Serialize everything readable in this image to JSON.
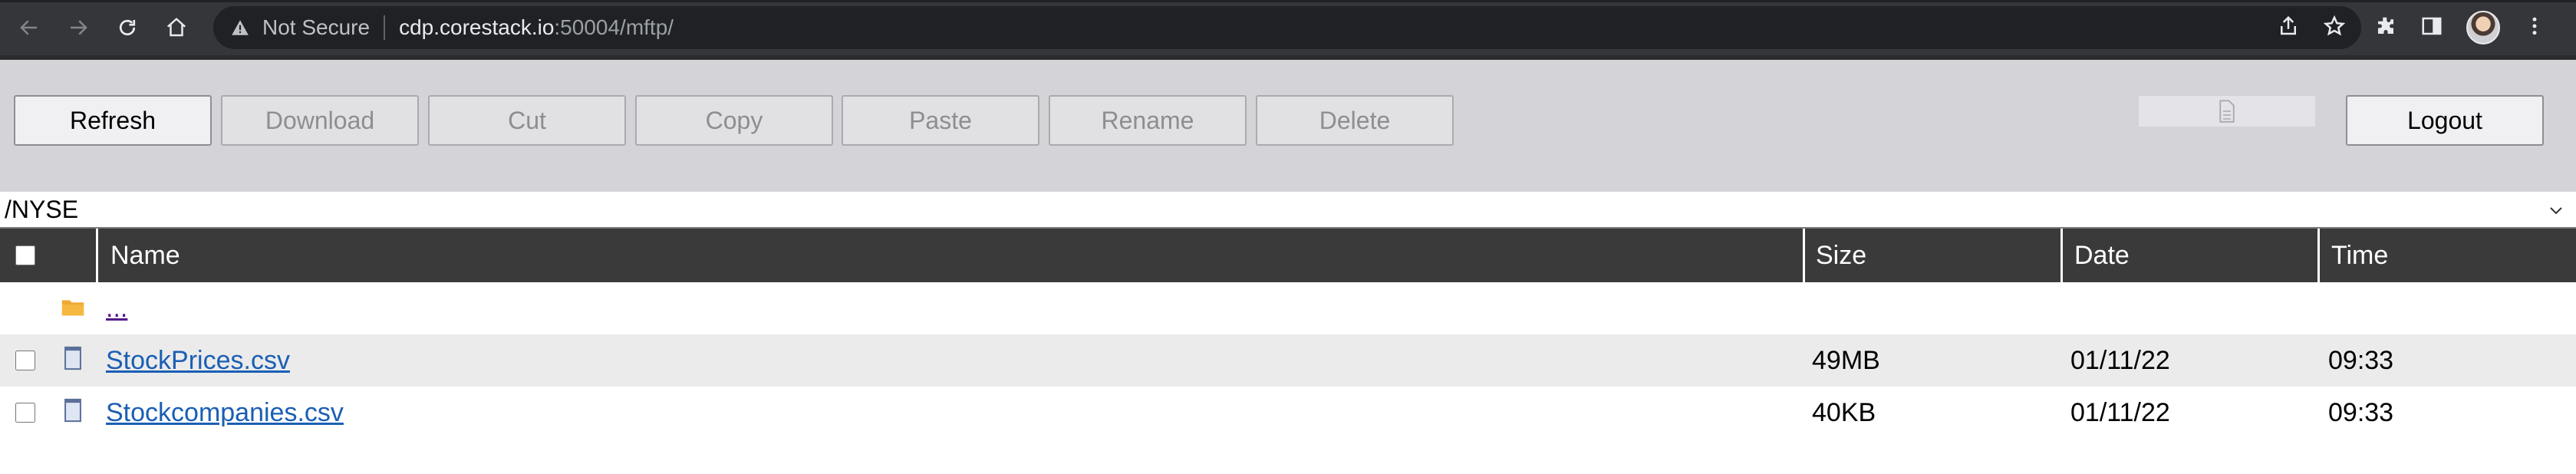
{
  "browser": {
    "security_label": "Not Secure",
    "url_host": "cdp.corestack.io",
    "url_rest": ":50004/mftp/"
  },
  "toolbar": {
    "refresh": "Refresh",
    "download": "Download",
    "cut": "Cut",
    "copy": "Copy",
    "paste": "Paste",
    "rename": "Rename",
    "delete": "Delete",
    "logout": "Logout"
  },
  "path": {
    "current": "/NYSE"
  },
  "table": {
    "columns": {
      "name": "Name",
      "size": "Size",
      "date": "Date",
      "time": "Time"
    },
    "parent_link": "...",
    "rows": [
      {
        "name": "StockPrices.csv",
        "size": "49MB",
        "date": "01/11/22",
        "time": "09:33"
      },
      {
        "name": "Stockcompanies.csv",
        "size": "40KB",
        "date": "01/11/22",
        "time": "09:33"
      }
    ]
  },
  "icons": {
    "back": "back-arrow-icon",
    "forward": "forward-arrow-icon",
    "reload": "reload-icon",
    "home": "home-icon",
    "warning": "warning-icon",
    "share": "share-icon",
    "bookmark": "star-icon",
    "extensions": "puzzle-icon",
    "sidepanel": "side-panel-icon",
    "menu": "kebab-menu-icon",
    "folder": "folder-icon",
    "file": "file-icon"
  },
  "colors": {
    "chrome_bg": "#35363a",
    "toolbar_bg": "#d4d4d8",
    "table_header_bg": "#3a3a3a",
    "link": "#1a5fb4",
    "folder": "#f0a830"
  }
}
